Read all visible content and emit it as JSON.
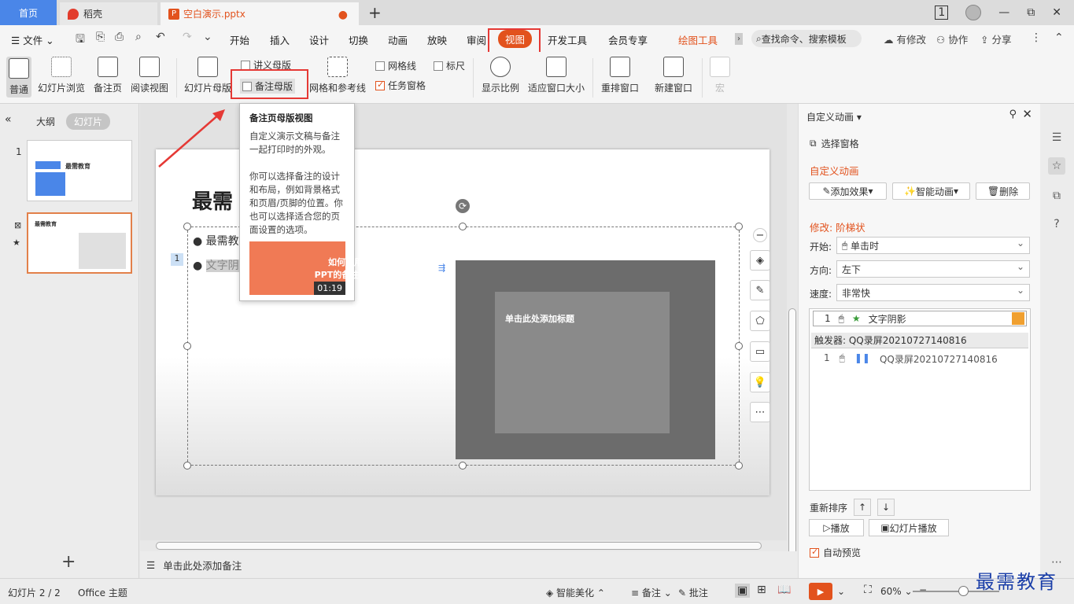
{
  "tabs": {
    "home": "首页",
    "daoke": "稻壳",
    "document": "空白演示.pptx",
    "unsaved_dot": "●",
    "plus": "+"
  },
  "window": {
    "badge": "1",
    "minimize": "—",
    "restore": "⧉",
    "close": "✕"
  },
  "menu": {
    "file": "文件",
    "items": [
      "开始",
      "插入",
      "设计",
      "切换",
      "动画",
      "放映",
      "审阅",
      "视图",
      "开发工具",
      "会员专享",
      "绘图工具"
    ],
    "search": "查找命令、搜索模板",
    "edit_status": "有修改",
    "collab": "协作",
    "share": "分享"
  },
  "ribbon": {
    "normal": "普通",
    "slide_browse": "幻灯片浏览",
    "notes_page": "备注页",
    "reading_view": "阅读视图",
    "slide_master": "幻灯片母版",
    "handout_master": "讲义母版",
    "notes_master": "备注母版",
    "grid_guides": "网格和参考线",
    "gridlines": "网格线",
    "ruler": "标尺",
    "task_pane": "任务窗格",
    "zoom": "显示比例",
    "fit_window": "适应窗口大小",
    "arrange": "重排窗口",
    "new_window": "新建窗口",
    "macro": "宏"
  },
  "leftpanel": {
    "outline": "大纲",
    "slides": "幻灯片",
    "slide1_num": "1",
    "slide2_num": "2",
    "slide1_title": "最需教育",
    "slide2_title": "最需教育",
    "add": "+"
  },
  "slide": {
    "title": "最需",
    "bullet1": "最需教",
    "bullet2": "文字阴",
    "num_tag": "1",
    "video_title": "单击此处添加标题"
  },
  "tooltip": {
    "title": "备注页母版视图",
    "body": "自定义演示文稿与备注一起打印时的外观。\n\n你可以选择备注的设计和布局，例如背景格式和页眉/页脚的位置。你也可以选择适合您的页面设置的选项。",
    "video_line1": "如何使用",
    "video_line2": "PPT的备注母版",
    "duration": "01:19"
  },
  "notes": {
    "placeholder": "单击此处添加备注"
  },
  "rightpane": {
    "title": "自定义动画",
    "select_pane": "选择窗格",
    "section": "自定义动画",
    "add_effect": "添加效果",
    "smart_anim": "智能动画",
    "delete": "删除",
    "modify": "修改: 阶梯状",
    "start_label": "开始:",
    "start_value": "单击时",
    "direction_label": "方向:",
    "direction_value": "左下",
    "speed_label": "速度:",
    "speed_value": "非常快",
    "item1_num": "1",
    "item1_name": "文字阴影",
    "trigger": "触发器: QQ录屏20210727140816",
    "item2_num": "1",
    "item2_name": "QQ录屏20210727140816",
    "reorder": "重新排序",
    "play": "播放",
    "slideshow": "幻灯片播放",
    "autopreview": "自动预览"
  },
  "status": {
    "slide": "幻灯片 2 / 2",
    "theme": "Office 主题",
    "smart_beautify": "智能美化",
    "notes": "备注",
    "comments": "批注",
    "zoom": "60%"
  },
  "watermark": "最需教育",
  "colors": {
    "accent": "#e2521d",
    "home_tab": "#4a86e8",
    "highlight": "#e53935"
  }
}
